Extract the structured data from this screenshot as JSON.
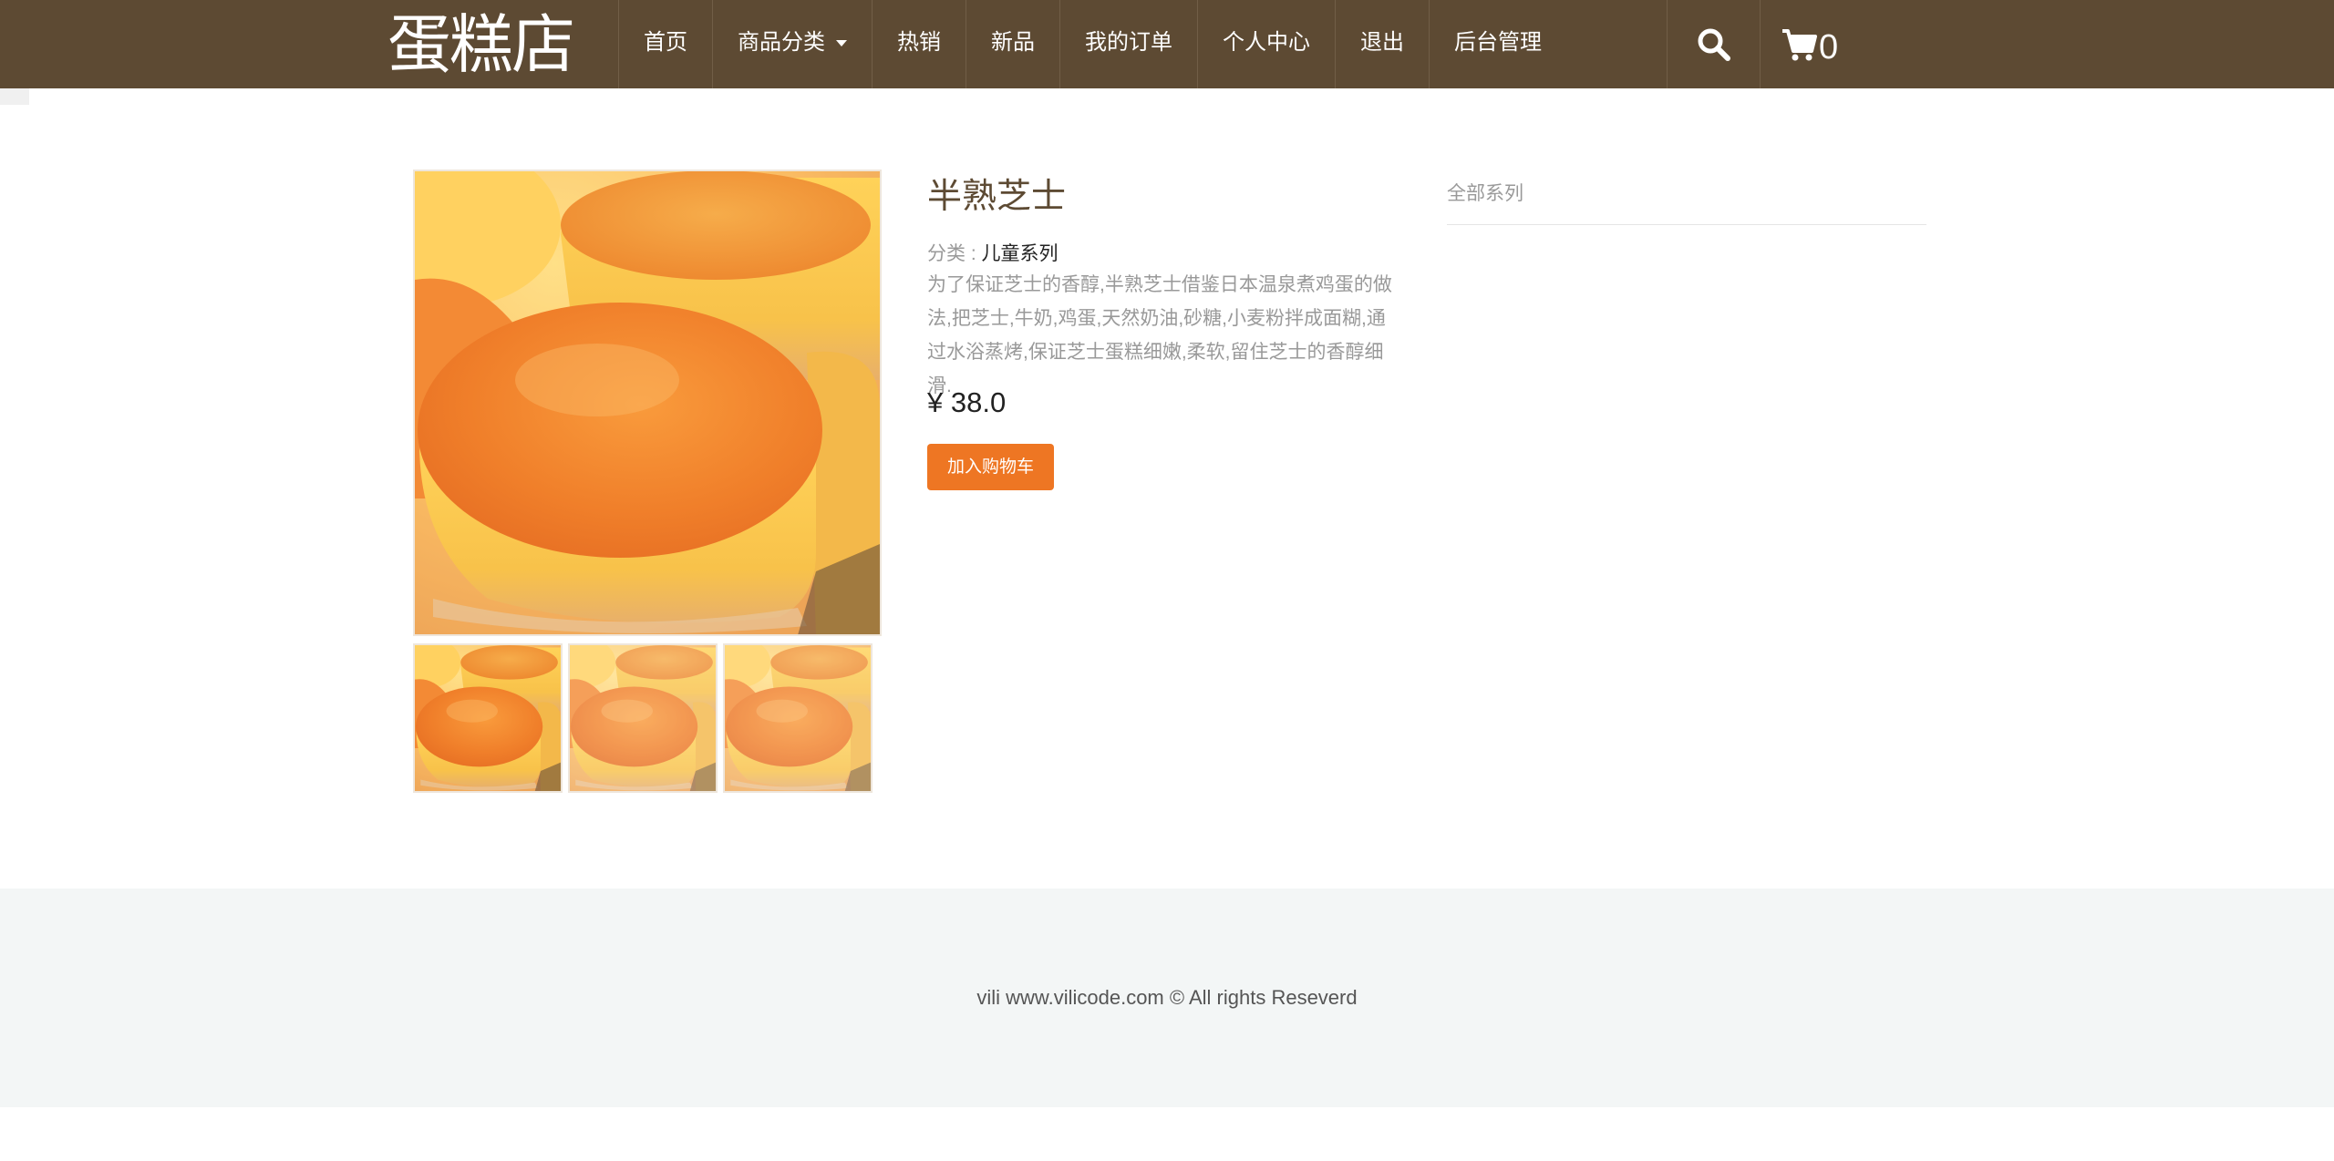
{
  "header": {
    "logo": "蛋糕店",
    "nav": [
      {
        "label": "首页"
      },
      {
        "label": "商品分类"
      },
      {
        "label": "热销"
      },
      {
        "label": "新品"
      },
      {
        "label": "我的订单"
      },
      {
        "label": "个人中心"
      },
      {
        "label": "退出"
      },
      {
        "label": "后台管理"
      }
    ],
    "search_icon": "search-icon",
    "cart_icon": "cart-icon",
    "cart_count": "0"
  },
  "product": {
    "title": "半熟芝士",
    "category_label": "分类 : ",
    "category_value": "儿童系列",
    "description": "为了保证芝士的香醇,半熟芝士借鉴日本温泉煮鸡蛋的做法,把芝士,牛奶,鸡蛋,天然奶油,砂糖,小麦粉拌成面糊,通过水浴蒸烤,保证芝士蛋糕细嫩,柔软,留住芝士的香醇细滑.",
    "price": "¥ 38.0",
    "add_to_cart_label": "加入购物车",
    "thumbnail_count": 3
  },
  "sidebar": {
    "title": "全部系列"
  },
  "footer": {
    "copyright": "vili www.vilicode.com © All rights Reseverd"
  },
  "colors": {
    "header_bg": "#5d4a33",
    "accent": "#ee7623",
    "footer_bg": "#f3f6f6"
  }
}
